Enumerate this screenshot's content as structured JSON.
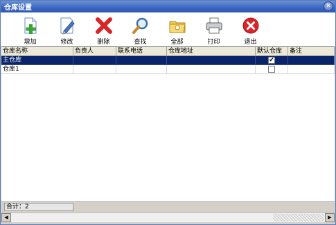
{
  "window": {
    "title": "仓库设置"
  },
  "toolbar": {
    "buttons": [
      {
        "label": "增加",
        "icon": "add-icon"
      },
      {
        "label": "修改",
        "icon": "edit-icon"
      },
      {
        "label": "删除",
        "icon": "delete-icon"
      },
      {
        "label": "查找",
        "icon": "search-icon"
      },
      {
        "label": "全部",
        "icon": "folder-icon"
      },
      {
        "label": "打印",
        "icon": "printer-icon"
      },
      {
        "label": "退出",
        "icon": "exit-icon"
      }
    ]
  },
  "table": {
    "columns": [
      "仓库名称",
      "负责人",
      "联系电话",
      "仓库地址",
      "默认仓库",
      "备注"
    ],
    "rows": [
      {
        "name": "主仓库",
        "manager": "",
        "phone": "",
        "address": "",
        "default": true,
        "note": ""
      },
      {
        "name": "仓库1",
        "manager": "",
        "phone": "",
        "address": "",
        "default": false,
        "note": ""
      }
    ]
  },
  "footer": {
    "total": "合计：2"
  },
  "colors": {
    "title_bar": "#3a66c2",
    "selected_row": "#0a246a",
    "accent_red": "#d9252a"
  }
}
